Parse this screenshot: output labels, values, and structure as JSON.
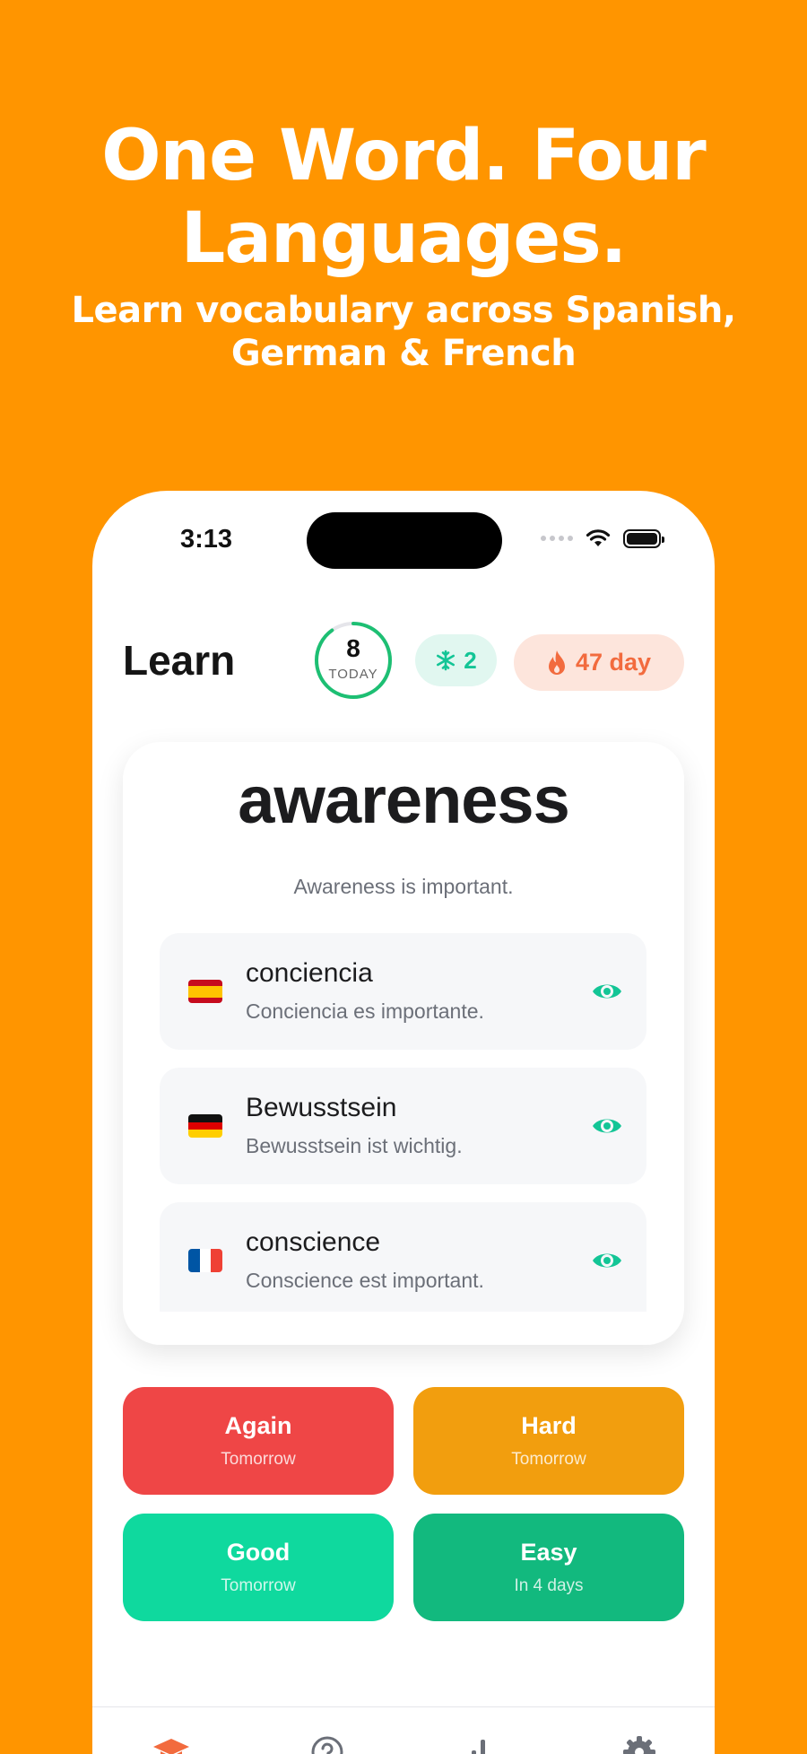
{
  "promo": {
    "headline_line1": "One Word. Four",
    "headline_line2": "Languages.",
    "subhead_line1": "Learn vocabulary across Spanish,",
    "subhead_line2": "German & French"
  },
  "status_bar": {
    "time": "3:13"
  },
  "header": {
    "title": "Learn",
    "today_count": "8",
    "today_label": "TODAY",
    "freeze_count": "2",
    "streak": "47 day"
  },
  "card": {
    "word": "awareness",
    "example": "Awareness is important.",
    "translations": [
      {
        "lang": "es",
        "flag_icon": "spain-flag-icon",
        "word": "conciencia",
        "sentence": "Conciencia es importante."
      },
      {
        "lang": "de",
        "flag_icon": "germany-flag-icon",
        "word": "Bewusstsein",
        "sentence": "Bewusstsein ist wichtig."
      },
      {
        "lang": "fr",
        "flag_icon": "france-flag-icon",
        "word": "conscience",
        "sentence": "Conscience est important."
      }
    ]
  },
  "answers": [
    {
      "label": "Again",
      "sub": "Tomorrow",
      "color": "#EF4646"
    },
    {
      "label": "Hard",
      "sub": "Tomorrow",
      "color": "#F29E0E"
    },
    {
      "label": "Good",
      "sub": "Tomorrow",
      "color": "#0FD99E"
    },
    {
      "label": "Easy",
      "sub": "In 4 days",
      "color": "#12B97E"
    }
  ],
  "colors": {
    "background": "#FF9500",
    "accent": "#13C596",
    "streak": "#F26B3E"
  },
  "tab_icons": [
    "learn-tab-icon",
    "quiz-tab-icon",
    "stats-tab-icon",
    "settings-tab-icon"
  ]
}
